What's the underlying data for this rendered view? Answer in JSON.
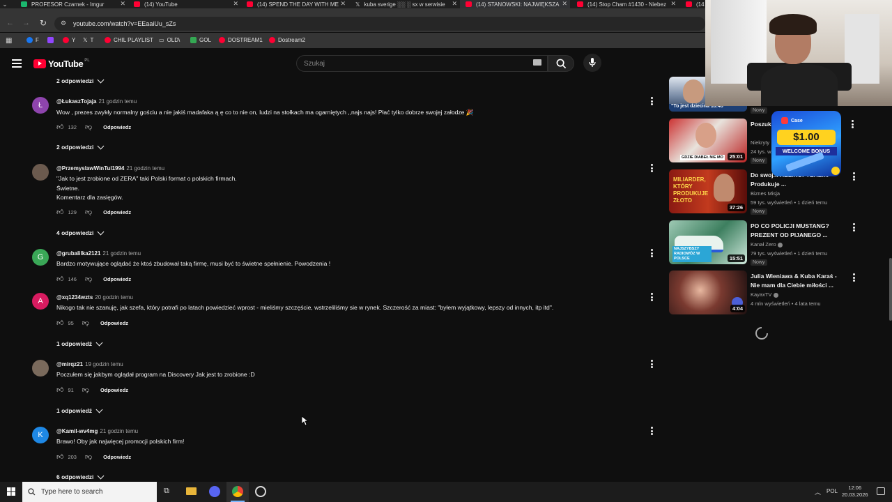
{
  "browser": {
    "tabs": [
      {
        "title": "PROFESOR Czarnek - Imgur",
        "color": "#1bb76e"
      },
      {
        "title": "(14) YouTube",
        "color": "#ff0033"
      },
      {
        "title": "(14) SPEND THE DAY WITH ME",
        "color": "#ff0033"
      },
      {
        "title": "kuba sverige ░░ ░ sx w serwisie",
        "color": "#bbbbbb"
      },
      {
        "title": "(14) STANOWSKI: NAJWIĘKSZA",
        "color": "#ff0033"
      },
      {
        "title": "(14) Stop Cham #1430 - Niebez",
        "color": "#ff0033"
      },
      {
        "title": "(14",
        "color": "#ff0033"
      }
    ],
    "url": "youtube.com/watch?v=EEaaiUu_sZs",
    "bookmarks": [
      {
        "label": "F",
        "color": "#1877f2"
      },
      {
        "label": "",
        "color": "#9146ff"
      },
      {
        "label": "Y",
        "color": "#ff0033"
      },
      {
        "label": "T",
        "color": "#ffffff"
      },
      {
        "label": "CHIL PLAYLIST",
        "color": "#ff0033"
      },
      {
        "label": "OLD\\",
        "color": "#aaaaaa"
      },
      {
        "label": "GOL",
        "color": "#34a853"
      },
      {
        "label": "DOSTREAM1",
        "color": "#ff0033"
      },
      {
        "label": "Dostream2",
        "color": "#ff0033"
      }
    ]
  },
  "youtube": {
    "logo": "YouTube",
    "region": "PL",
    "search_placeholder": "Szukaj",
    "icons": {
      "menu": "menu-icon",
      "search": "search-icon",
      "mic": "microphone-icon",
      "keyboard": "keyboard-icon"
    }
  },
  "comments": {
    "top_replies": "2 odpowiedzi",
    "reply_label": "Odpowiedz",
    "items": [
      {
        "author": "@ŁukaszTojaja",
        "time": "21 godzin temu",
        "avatar_letter": "Ł",
        "avatar_color": "#8e44ad",
        "lines": [
          "Wow , prezes zwykły normalny gościu a nie jakiś madafaka ą ę co to nie on, ludzi na stołkach ma ogarniętych ,,najs najs! Płać tylko dobrze swojej załodze 🎉"
        ],
        "likes": "132",
        "replies": "2 odpowiedzi"
      },
      {
        "author": "@PrzemyslawWinTul1994",
        "time": "21 godzin temu",
        "avatar_letter": "",
        "avatar_color": "#6b5a4e",
        "lines": [
          "\"Jak to jest zrobione od ZERA\" taki Polski format o polskich firmach.",
          "Świetne.",
          "Komentarz dla zasięgów."
        ],
        "likes": "129",
        "replies": "4 odpowiedzi"
      },
      {
        "author": "@grubalilka2121",
        "time": "21 godzin temu",
        "avatar_letter": "G",
        "avatar_color": "#3aa757",
        "lines": [
          "Bardzo motywujące oglądać że ktoś zbudował taką firmę, musi być to świetne spełnienie. Powodzenia !"
        ],
        "likes": "146",
        "replies": ""
      },
      {
        "author": "@xq1234wzts",
        "time": "20 godzin temu",
        "avatar_letter": "A",
        "avatar_color": "#d81b60",
        "lines": [
          "Nikogo tak nie szanuję, jak szefa, który potrafi po latach powiedzieć wprost - mieliśmy szczęście, wstrzeliliśmy sie w rynek. Szczerość za miast: \"byłem wyjątkowy, lepszy od innych, itp itd\"."
        ],
        "likes": "95",
        "replies": "1 odpowiedź"
      },
      {
        "author": "@mirqz21",
        "time": "19 godzin temu",
        "avatar_letter": "",
        "avatar_color": "#7a6a5c",
        "lines": [
          "Poczułem się jakbym oglądał program na Discovery Jak jest to zrobione :D"
        ],
        "likes": "91",
        "replies": "1 odpowiedź"
      },
      {
        "author": "@Kamil-wv4mg",
        "time": "21 godzin temu",
        "avatar_letter": "K",
        "avatar_color": "#1e88e5",
        "lines": [
          "Brawo! Oby jak najwięcej promocji polskich firm!"
        ],
        "likes": "203",
        "replies": "6 odpowiedzi"
      }
    ]
  },
  "sidebar": {
    "videos": [
      {
        "title": "",
        "thumb_text": "\"To jest dziecina 18:45",
        "thumb_color": "#3b5b86",
        "channel": "",
        "meta": "",
        "new": "Nowy",
        "duration": ""
      },
      {
        "title": "Poszuk... Małżeń...",
        "thumb_text": "GDZIE DIABEŁ NIE MO",
        "thumb_color": "#a82a2a",
        "channel": "Niekryty",
        "meta": "24 tys. w...",
        "new": "Nowy",
        "duration": "25:01"
      },
      {
        "title": "Do swoj... HELIKOPTEREM. Produkuje ...",
        "thumb_text": "MILIARDER, KTÓRY PRODUKUJE ZŁOTO",
        "thumb_color": "#7a1410",
        "channel": "Biznes Misja",
        "meta": "59 tys. wyświetleń • 1 dzień temu",
        "new": "Nowy",
        "duration": "37:26"
      },
      {
        "title": "PO CO POLICJI MUSTANG? PREZENT OD PIJANEGO ...",
        "thumb_text": "NAJSZYBSZY RADIOWÓZ W POLSCE",
        "thumb_color": "#2e6b4a",
        "channel": "Kanał Zero",
        "meta": "79 tys. wyświetleń • 1 dzień temu",
        "new": "Nowy",
        "duration": "15:51"
      },
      {
        "title": "Julia Wieniawa & Kuba Karaś - Nie mam dla Ciebie miłości ...",
        "thumb_text": "",
        "thumb_color": "#5a2a2a",
        "channel": "KayaxTV",
        "meta": "4 mln wyświetleń • 4 lata temu",
        "new": "",
        "duration": "4:04"
      }
    ],
    "ad": {
      "brand": "Case",
      "amount": "$1.00",
      "caption": "WELCOME BONUS"
    }
  },
  "taskbar": {
    "search_placeholder": "Type here to search",
    "lang": "POL",
    "time": "12:06",
    "date": "20.03.2026"
  }
}
